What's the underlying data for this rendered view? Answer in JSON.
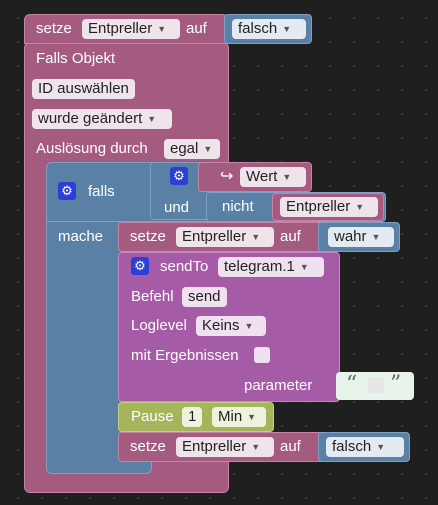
{
  "set_top": {
    "label": "setze",
    "var": "Entpreller",
    "auf": "auf",
    "value": "falsch"
  },
  "trigger": {
    "title": "Falls Objekt",
    "id_select": "ID auswählen",
    "change": "wurde geändert",
    "trigger_label": "Auslösung durch",
    "trigger_value": "egal"
  },
  "if_block": {
    "falls": "falls",
    "mache": "mache",
    "und": "und",
    "nicht": "nicht",
    "wert": "Wert",
    "var": "Entpreller"
  },
  "set_true": {
    "label": "setze",
    "var": "Entpreller",
    "auf": "auf",
    "value": "wahr"
  },
  "send": {
    "label": "sendTo",
    "instance": "telegram.1",
    "befehl_label": "Befehl",
    "befehl_value": "send",
    "loglevel_label": "Loglevel",
    "loglevel_value": "Keins",
    "results_label": "mit Ergebnissen",
    "parameter_label": "parameter"
  },
  "pause": {
    "label": "Pause",
    "value": "1",
    "unit": "Min"
  },
  "set_false": {
    "label": "setze",
    "var": "Entpreller",
    "auf": "auf",
    "value": "falsch"
  },
  "icons": {
    "gear": "gear-icon",
    "arrow": "return-arrow-icon",
    "quote": "quote-icon"
  }
}
